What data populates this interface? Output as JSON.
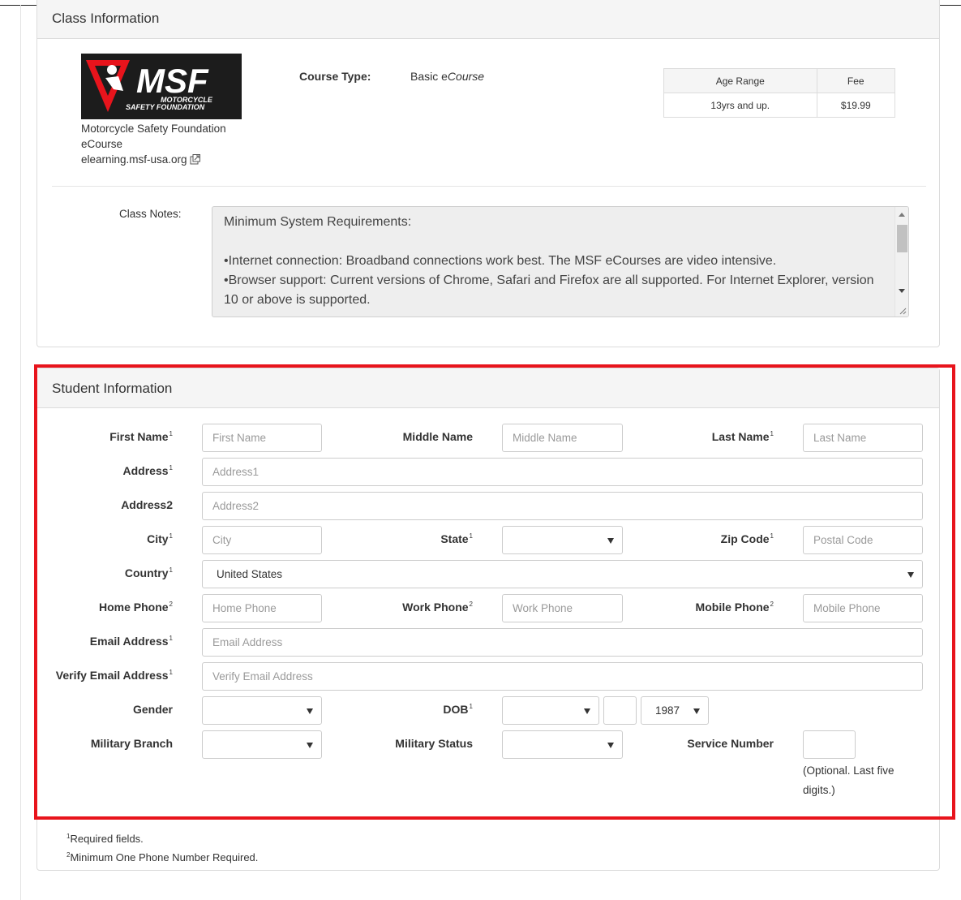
{
  "class_info": {
    "title": "Class Information",
    "logo_text": "MSF",
    "logo_subtext_1": "MOTORCYCLE",
    "logo_subtext_2": "SAFETY FOUNDATION",
    "provider_name": "Motorcycle Safety Foundation",
    "provider_course": "eCourse",
    "provider_link": "elearning.msf-usa.org",
    "course_type_label": "Course Type:",
    "course_type_value_prefix": "Basic e",
    "course_type_value_italic": "Course",
    "fee_table": {
      "headers": [
        "Age Range",
        "Fee"
      ],
      "rows": [
        [
          "13yrs and up.",
          "$19.99"
        ]
      ]
    },
    "class_notes_label": "Class Notes:",
    "class_notes_lines": [
      "Minimum System Requirements:",
      "",
      "•Internet connection: Broadband connections work best. The MSF eCourses are video intensive.",
      "•Browser support: Current versions of Chrome, Safari and Firefox are all supported. For Internet Explorer, version 10 or above is supported."
    ]
  },
  "student_info": {
    "title": "Student Information",
    "fields": {
      "first_name": {
        "label": "First Name",
        "sup": "1",
        "placeholder": "First Name"
      },
      "middle_name": {
        "label": "Middle Name",
        "placeholder": "Middle Name"
      },
      "last_name": {
        "label": "Last Name",
        "sup": "1",
        "placeholder": "Last Name"
      },
      "address1": {
        "label": "Address",
        "sup": "1",
        "placeholder": "Address1"
      },
      "address2": {
        "label": "Address2",
        "placeholder": "Address2"
      },
      "city": {
        "label": "City",
        "sup": "1",
        "placeholder": "City"
      },
      "state": {
        "label": "State",
        "sup": "1",
        "value": ""
      },
      "zip": {
        "label": "Zip Code",
        "sup": "1",
        "placeholder": "Postal Code"
      },
      "country": {
        "label": "Country",
        "sup": "1",
        "value": "United States"
      },
      "home_phone": {
        "label": "Home Phone",
        "sup": "2",
        "placeholder": "Home Phone"
      },
      "work_phone": {
        "label": "Work Phone",
        "sup": "2",
        "placeholder": "Work Phone"
      },
      "mobile_phone": {
        "label": "Mobile Phone",
        "sup": "2",
        "placeholder": "Mobile Phone"
      },
      "email": {
        "label": "Email Address",
        "sup": "1",
        "placeholder": "Email Address"
      },
      "verify_email": {
        "label": "Verify Email Address",
        "sup": "1",
        "placeholder": "Verify Email Address"
      },
      "gender": {
        "label": "Gender",
        "value": ""
      },
      "dob": {
        "label": "DOB",
        "sup": "1",
        "month": "",
        "day": "",
        "year": "1987"
      },
      "military_branch": {
        "label": "Military Branch",
        "value": ""
      },
      "military_status": {
        "label": "Military Status",
        "value": ""
      },
      "service_number": {
        "label": "Service Number",
        "hint": "(Optional. Last five digits.)"
      }
    }
  },
  "footnotes": {
    "note1": "Required fields.",
    "note2": "Minimum One Phone Number Required.",
    "sup1": "1",
    "sup2": "2"
  },
  "colors": {
    "highlight": "#e8141c",
    "panel_header": "#f5f5f5",
    "border": "#dcdcdc"
  }
}
